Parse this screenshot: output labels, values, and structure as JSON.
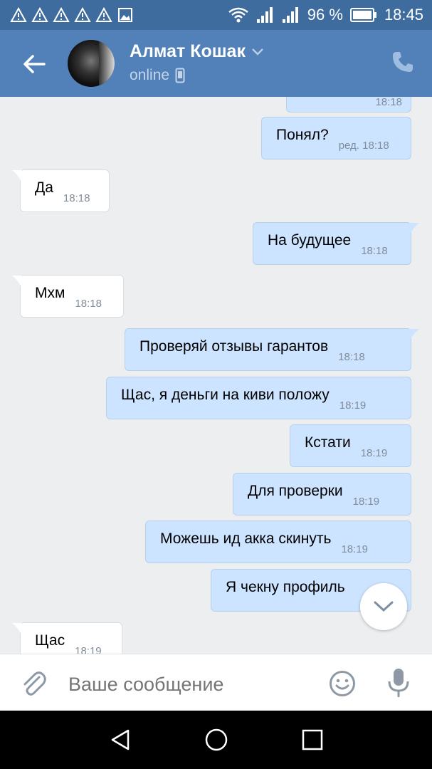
{
  "status_bar": {
    "battery": "96 %",
    "time": "18:45"
  },
  "header": {
    "contact_name": "Алмат Кошак",
    "status": "online"
  },
  "messages": [
    {
      "dir": "out",
      "text": "",
      "time": "18:18"
    },
    {
      "dir": "out",
      "text": "Понял?",
      "time": "ред. 18:18"
    },
    {
      "dir": "in",
      "text": "Да",
      "time": "18:18"
    },
    {
      "dir": "out",
      "text": "На будущее",
      "time": "18:18"
    },
    {
      "dir": "in",
      "text": "Мхм",
      "time": "18:18"
    },
    {
      "dir": "out",
      "text": "Проверяй отзывы гарантов",
      "time": "18:18"
    },
    {
      "dir": "out",
      "text": "Щас, я деньги на киви положу",
      "time": "18:19"
    },
    {
      "dir": "out",
      "text": "Кстати",
      "time": "18:19"
    },
    {
      "dir": "out",
      "text": "Для проверки",
      "time": "18:19"
    },
    {
      "dir": "out",
      "text": "Можешь ид акка скинуть",
      "time": "18:19"
    },
    {
      "dir": "out",
      "text": "Я чекну профиль",
      "time": ""
    },
    {
      "dir": "in",
      "text": "Щас",
      "time": "18:19"
    }
  ],
  "composer": {
    "placeholder": "Ваше сообщение"
  },
  "colors": {
    "header": "#5181b8",
    "status_bar": "#3f6c9f",
    "outgoing_bubble": "#cce4ff",
    "incoming_bubble": "#ffffff",
    "background": "#edeef0"
  },
  "icons": {
    "back": "arrow-left-icon",
    "call": "phone-icon",
    "attach": "paperclip-icon",
    "emoji": "smiley-icon",
    "voice": "microphone-icon",
    "scroll": "chevron-down-icon"
  }
}
